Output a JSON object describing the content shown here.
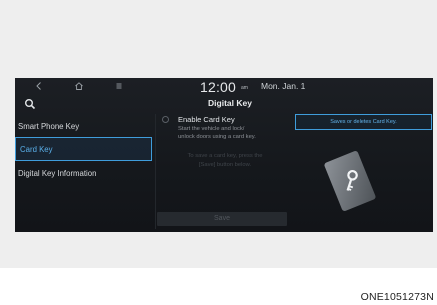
{
  "status_bar": {
    "back_icon": "back-icon",
    "home_icon": "home-icon",
    "menu_icon": "menu-icon",
    "time": "12:00",
    "ampm": "am",
    "date": "Mon. Jan. 1"
  },
  "header": {
    "search_icon": "search-icon",
    "title": "Digital Key"
  },
  "sidebar": {
    "items": [
      {
        "label": "Smart Phone Key"
      },
      {
        "label": "Card Key",
        "selected": true
      },
      {
        "label": "Digital Key Information"
      }
    ]
  },
  "content": {
    "enable_label": "Enable Card Key",
    "enable_checked": false,
    "enable_desc_line1": "Start the vehicle and lock/",
    "enable_desc_line2": "unlock doors using a card key.",
    "instruction_line1": "To save a card key, press the",
    "instruction_line2": "[Save] button below.",
    "save_label": "Save",
    "card_image_icon": "card-key-icon"
  },
  "tooltip": {
    "text": "Saves or deletes Card Key."
  },
  "figure_code": "ONE1051273N",
  "colors": {
    "accent": "#3f9ddb",
    "screen_bg": "#16191d",
    "selected_text": "#5ab0ea"
  }
}
